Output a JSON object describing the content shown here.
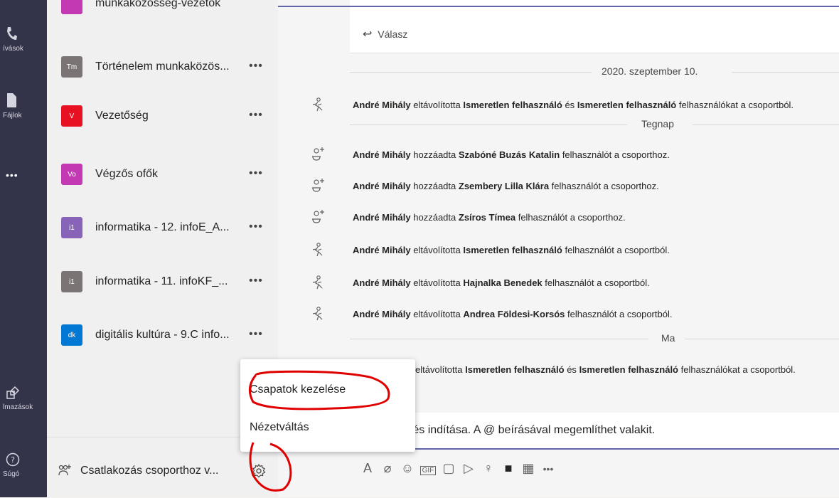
{
  "rail": {
    "items": [
      {
        "label": "ívások",
        "icon": "phone-icon"
      },
      {
        "label": "Fájlok",
        "icon": "file-icon"
      },
      {
        "label": "",
        "icon": "more-icon"
      },
      {
        "label": "lmazások",
        "icon": "apps-icon"
      },
      {
        "label": "Súgó",
        "icon": "help-icon"
      }
    ]
  },
  "teams": {
    "partial_top_name": "munkaközösség-vezetők",
    "items": [
      {
        "abbr": "Tm",
        "name": "Történelem munkaközös...",
        "color": "#7a7574"
      },
      {
        "abbr": "V",
        "name": "Vezetőség",
        "color": "#e81123"
      },
      {
        "abbr": "Vo",
        "name": "Végzős ofők",
        "color": "#c239b3"
      },
      {
        "abbr": "i1",
        "name": "informatika - 12. infoE_A...",
        "color": "#8764b8"
      },
      {
        "abbr": "i1",
        "name": "informatika - 11. infoKF_...",
        "color": "#7a7574"
      },
      {
        "abbr": "dk",
        "name": "digitális kultúra - 9.C info...",
        "color": "#0078d4"
      }
    ],
    "more_label": "•••",
    "join_label": "Csatlakozás csoporthoz v..."
  },
  "conversation": {
    "reply_label": "Válasz",
    "date_dividers": {
      "d1": "2020. szeptember 10.",
      "d2": "Tegnap",
      "d3": "Ma"
    },
    "events": [
      {
        "icon": "remove-user-icon",
        "actor": "André Mihály",
        "verb": "eltávolította",
        "target": "Ismeretlen felhasználó",
        "joiner": "és",
        "target2": "Ismeretlen felhasználó",
        "suffix": "felhasználókat a csoportból."
      },
      {
        "icon": "add-user-icon",
        "actor": "André Mihály",
        "verb": "hozzáadta",
        "target": "Szabóné Buzás Katalin",
        "suffix": "felhasználót a csoporthoz."
      },
      {
        "icon": "add-user-icon",
        "actor": "André Mihály",
        "verb": "hozzáadta",
        "target": "Zsembery Lilla Klára",
        "suffix": "felhasználót a csoporthoz."
      },
      {
        "icon": "add-user-icon",
        "actor": "André Mihály",
        "verb": "hozzáadta",
        "target": "Zsíros Tímea",
        "suffix": "felhasználót a csoporthoz."
      },
      {
        "icon": "remove-user-icon",
        "actor": "André Mihály",
        "verb": "eltávolította",
        "target": "Ismeretlen felhasználó",
        "suffix": "felhasználót a csoportból."
      },
      {
        "icon": "remove-user-icon",
        "actor": "André Mihály",
        "verb": "eltávolította",
        "target": "Hajnalka Benedek",
        "suffix": "felhasználót a csoportból."
      },
      {
        "icon": "remove-user-icon",
        "actor": "André Mihály",
        "verb": "eltávolította",
        "target": "Andrea Földesi-Korsós",
        "suffix": "felhasználót a csoportból."
      }
    ],
    "last_event": {
      "verb_partial": "eltávolította",
      "target": "Ismeretlen felhasználó",
      "joiner": "és",
      "target2": "Ismeretlen felhasználó",
      "suffix": "felhasználókat a csoportból."
    },
    "composer_placeholder": "etés indítása. A @ beírásával megemlíthet valakit."
  },
  "context_menu": {
    "manage_teams": "Csapatok kezelése",
    "switch_view": "Nézetváltás"
  },
  "colors": {
    "rail": "#33344a",
    "accent": "#6264a7",
    "annotation": "#e00000"
  }
}
